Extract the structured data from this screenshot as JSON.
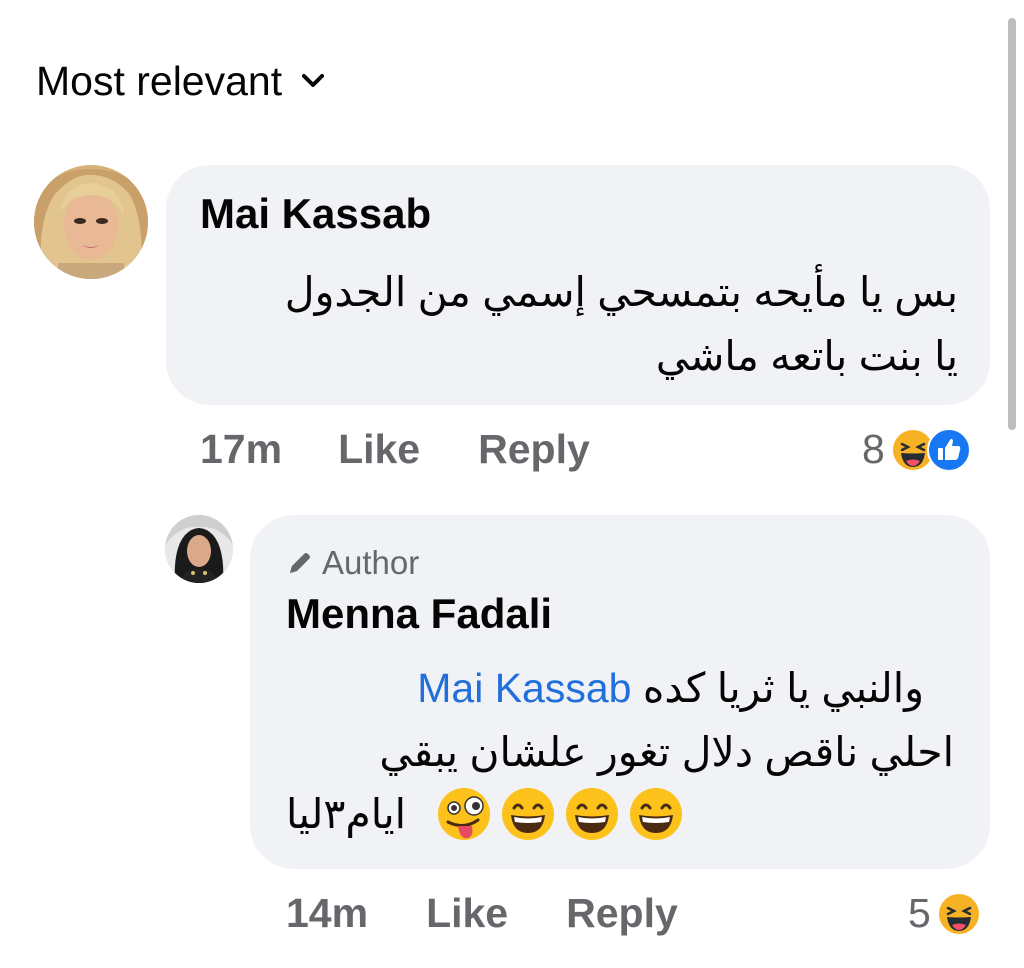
{
  "sort": {
    "label": "Most relevant"
  },
  "comments": [
    {
      "author": "Mai Kassab",
      "text_line1": "بس يا مأيحه بتمسحي إسمي من الجدول",
      "text_line2": "يا بنت باتعه ماشي",
      "time": "17m",
      "like_label": "Like",
      "reply_label": "Reply",
      "reaction_count": "8",
      "reactions": [
        "haha-icon",
        "like-icon"
      ]
    }
  ],
  "reply": {
    "badge": "Author",
    "author": "Menna Fadali",
    "mention": "Mai Kassab",
    "text_line1": "والنبي يا ثريا كده",
    "text_line2": "احلي ناقص دلال تغور علشان يبقي",
    "text_line3": "ايام٣ليا",
    "emojis": [
      "grinning-face-icon",
      "grinning-face-icon",
      "grinning-face-icon",
      "winking-tongue-face-icon"
    ],
    "time": "14m",
    "like_label": "Like",
    "reply_label": "Reply",
    "reaction_count": "5",
    "reactions": [
      "haha-icon"
    ]
  },
  "colors": {
    "bubble": "#f0f2f5",
    "meta": "#65676b",
    "mention": "#216fdb",
    "like_blue": "#1877f2"
  }
}
